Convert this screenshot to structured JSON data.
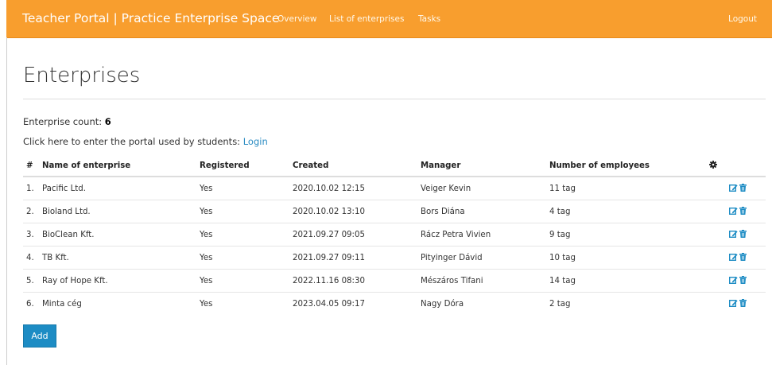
{
  "header": {
    "brand": "Teacher Portal | Practice Enterprise Space",
    "nav": [
      "Overview",
      "List of enterprises",
      "Tasks"
    ],
    "logout": "Logout"
  },
  "page_title": "Enterprises",
  "summary": {
    "count_label": "Enterprise count:",
    "count_value": "6",
    "portal_text": "Click here to enter the portal used by students:",
    "portal_link": "Login"
  },
  "table": {
    "columns": [
      "#",
      "Name of enterprise",
      "Registered",
      "Created",
      "Manager",
      "Number of employees",
      "settings-icon"
    ],
    "rows": [
      {
        "no": "1.",
        "name": "Pacific Ltd.",
        "registered": "Yes",
        "created": "2020.10.02 12:15",
        "manager": "Veiger Kevin",
        "employees": "11 tag"
      },
      {
        "no": "2.",
        "name": "Bioland Ltd.",
        "registered": "Yes",
        "created": "2020.10.02 13:10",
        "manager": "Bors Diána",
        "employees": "4 tag"
      },
      {
        "no": "3.",
        "name": "BioClean Kft.",
        "registered": "Yes",
        "created": "2021.09.27 09:05",
        "manager": "Rácz Petra Vivien",
        "employees": "9 tag"
      },
      {
        "no": "4.",
        "name": "TB Kft.",
        "registered": "Yes",
        "created": "2021.09.27 09:11",
        "manager": "Pityinger Dávid",
        "employees": "10 tag"
      },
      {
        "no": "5.",
        "name": "Ray of Hope Kft.",
        "registered": "Yes",
        "created": "2022.11.16 08:30",
        "manager": "Mészáros Tifani",
        "employees": "14 tag"
      },
      {
        "no": "6.",
        "name": "Minta cég",
        "registered": "Yes",
        "created": "2023.04.05 09:17",
        "manager": "Nagy Dóra",
        "employees": "2 tag"
      }
    ]
  },
  "add_button": "Add",
  "colors": {
    "header_bg": "#f89e2e",
    "link": "#2a8bc2",
    "action_icon": "#1d8cc4",
    "button_bg": "#1d8cc4"
  },
  "icons": {
    "header_settings": "gear-icon",
    "row_edit": "edit-icon",
    "row_delete": "trash-icon"
  }
}
